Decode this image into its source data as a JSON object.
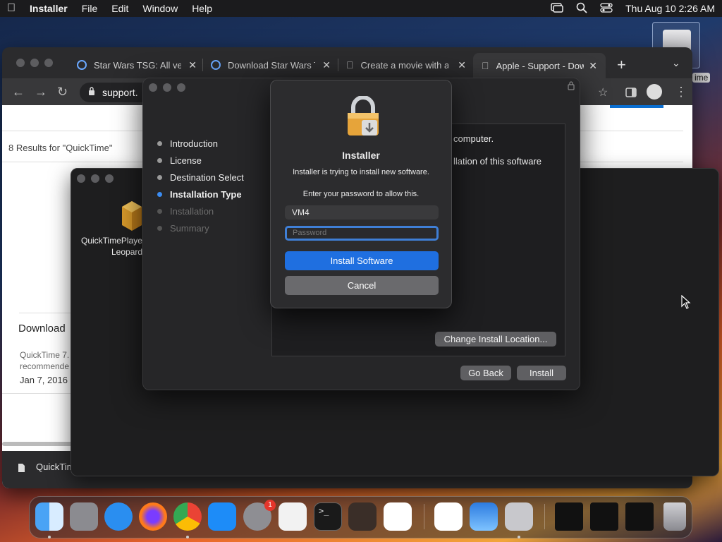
{
  "menubar": {
    "app_name": "Installer",
    "menus": [
      "File",
      "Edit",
      "Window",
      "Help"
    ],
    "clock": "Thu Aug 10  2:26 AM"
  },
  "desktop": {
    "drive_label": "ime"
  },
  "browser": {
    "tabs": [
      {
        "title": "Star Wars TSG: All ver"
      },
      {
        "title": "Download Star Wars T"
      },
      {
        "title": "Create a movie with ar"
      },
      {
        "title": "Apple - Support - Dow"
      }
    ],
    "omnibox_text": "support.",
    "page": {
      "results_text": "8 Results for \"QuickTime\"",
      "download_heading": "Download",
      "desc_line1": "QuickTime 7.",
      "desc_line2": "recommende",
      "date": "Jan 7, 2016",
      "file_label": "QuickTim"
    }
  },
  "installer": {
    "steps": [
      {
        "label": "Introduction",
        "state": "done"
      },
      {
        "label": "License",
        "state": "done"
      },
      {
        "label": "Destination Select",
        "state": "done"
      },
      {
        "label": "Installation Type",
        "state": "current"
      },
      {
        "label": "Installation",
        "state": "pending"
      },
      {
        "label": "Summary",
        "state": "pending"
      }
    ],
    "body_line1": "computer.",
    "body_line2": "llation of this software",
    "change_location_button": "Change Install Location...",
    "go_back_button": "Go Back",
    "install_button": "Install"
  },
  "finder": {
    "file_name_line1": "QuickTimePlaye",
    "file_name_line2": "Leopard"
  },
  "auth_dialog": {
    "title": "Installer",
    "message": "Installer is trying to install new software.",
    "prompt": "Enter your password to allow this.",
    "username_value": "VM4",
    "password_placeholder": "Password",
    "install_software_button": "Install Software",
    "cancel_button": "Cancel",
    "accent_color": "#1f6fe0"
  },
  "dock": {
    "items": [
      "finder",
      "launchpad",
      "safari",
      "firefox",
      "chrome",
      "app-store",
      "system-settings",
      "textedit",
      "terminal",
      "garageband",
      "vscode",
      "visual-studio",
      "weather",
      "installer"
    ],
    "system_settings_badge": "1"
  }
}
